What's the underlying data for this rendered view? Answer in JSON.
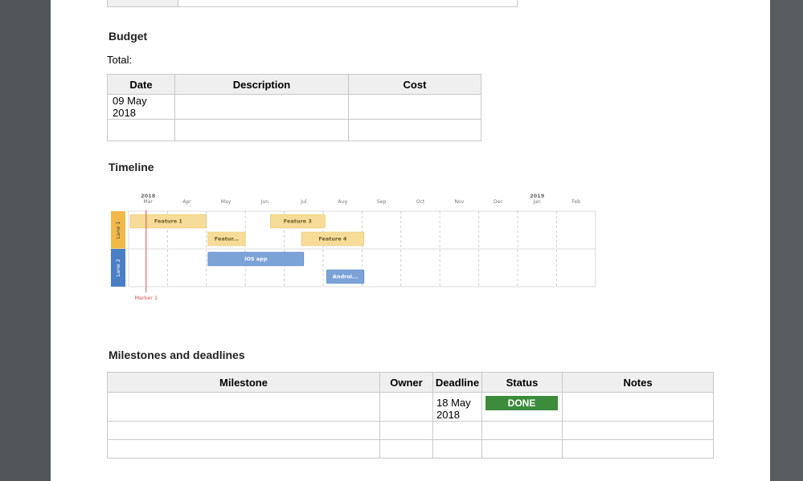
{
  "budget": {
    "heading": "Budget",
    "total_label": "Total:",
    "columns": [
      "Date",
      "Description",
      "Cost"
    ],
    "rows": [
      [
        "09 May 2018",
        "",
        ""
      ],
      [
        "",
        "",
        ""
      ]
    ]
  },
  "timeline": {
    "heading": "Timeline",
    "years": [
      {
        "label": "2018",
        "month_index": 0
      },
      {
        "label": "2019",
        "month_index": 10
      }
    ],
    "months": [
      "Mar",
      "Apr",
      "May",
      "Jun",
      "Jul",
      "Aug",
      "Sep",
      "Oct",
      "Nov",
      "Dec",
      "Jan",
      "Feb"
    ],
    "lanes": [
      {
        "label": "Lane 1",
        "color": "#f0b949"
      },
      {
        "label": "Lane 2",
        "color": "#4a7ec5"
      }
    ],
    "bars": [
      {
        "label": "Feature 1",
        "lane": 0,
        "row": 0,
        "start": 0.0,
        "end": 2.0,
        "color": "#f6dc98",
        "border": "#e8c46b",
        "text_color": "#6b5a2a"
      },
      {
        "label": "Featur...",
        "lane": 0,
        "row": 1,
        "start": 2.0,
        "end": 3.0,
        "color": "#f6dc98",
        "border": "#e8c46b",
        "text_color": "#6b5a2a"
      },
      {
        "label": "Feature 3",
        "lane": 0,
        "row": 0,
        "start": 3.6,
        "end": 5.05,
        "color": "#f6dc98",
        "border": "#e8c46b",
        "text_color": "#6b5a2a"
      },
      {
        "label": "Feature 4",
        "lane": 0,
        "row": 1,
        "start": 4.4,
        "end": 6.05,
        "color": "#f6dc98",
        "border": "#e8c46b",
        "text_color": "#6b5a2a"
      },
      {
        "label": "iOS app",
        "lane": 1,
        "row": 0,
        "start": 2.0,
        "end": 4.5,
        "color": "#7ca3d8",
        "border": "#4a7ec5",
        "text_color": "#ffffff"
      },
      {
        "label": "Androi...",
        "lane": 1,
        "row": 1,
        "start": 5.05,
        "end": 6.05,
        "color": "#7ca3d8",
        "border": "#4a7ec5",
        "text_color": "#ffffff"
      }
    ],
    "marker": {
      "label": "Marker 1",
      "position": 0.45,
      "color": "#d9534f"
    }
  },
  "milestones": {
    "heading": "Milestones and deadlines",
    "columns": [
      "Milestone",
      "Owner",
      "Deadline",
      "Status",
      "Notes"
    ],
    "rows": [
      {
        "milestone": "",
        "owner": "",
        "deadline": "18 May 2018",
        "status": "DONE",
        "notes": ""
      },
      {
        "milestone": "",
        "owner": "",
        "deadline": "",
        "status": "",
        "notes": ""
      },
      {
        "milestone": "",
        "owner": "",
        "deadline": "",
        "status": "",
        "notes": ""
      }
    ],
    "status_color": "#3c8c3c"
  }
}
